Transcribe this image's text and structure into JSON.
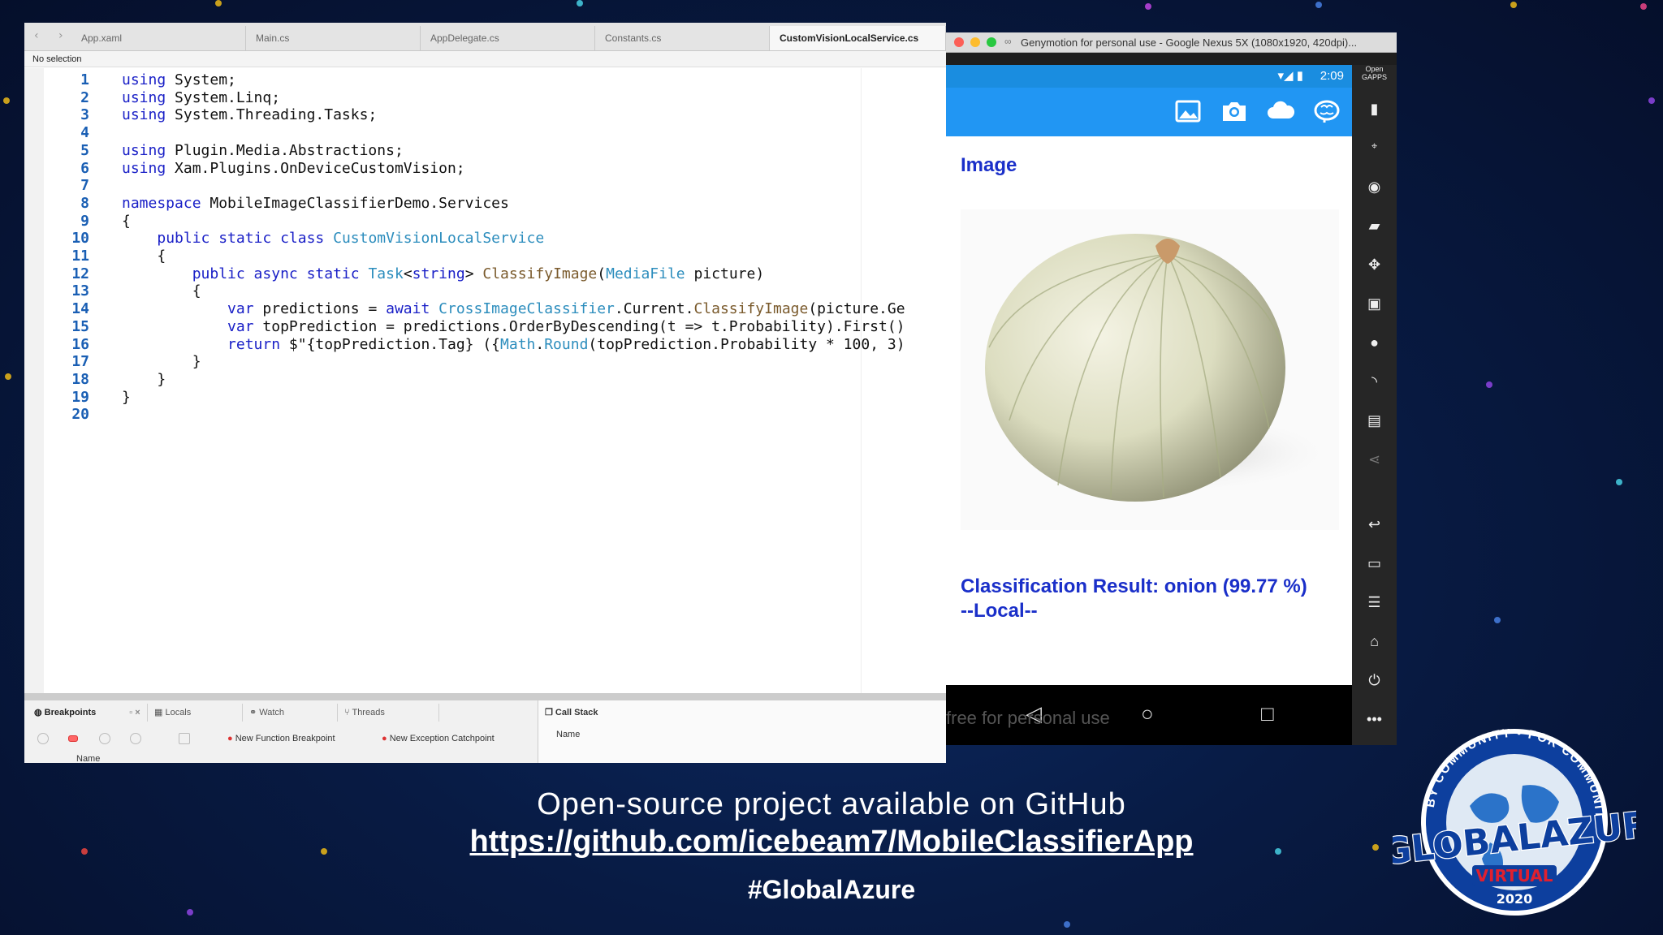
{
  "ide": {
    "tabs": [
      {
        "label": "App.xaml"
      },
      {
        "label": "Main.cs"
      },
      {
        "label": "AppDelegate.cs"
      },
      {
        "label": "Constants.cs"
      },
      {
        "label": "CustomVisionLocalService.cs",
        "active": true
      }
    ],
    "path_bar": "No selection",
    "code_lines": [
      {
        "n": "1",
        "tokens": [
          {
            "t": "using",
            "c": "kw"
          },
          {
            "t": " System;",
            "c": "pl"
          }
        ]
      },
      {
        "n": "2",
        "tokens": [
          {
            "t": "using",
            "c": "kw"
          },
          {
            "t": " System.Linq;",
            "c": "pl"
          }
        ]
      },
      {
        "n": "3",
        "tokens": [
          {
            "t": "using",
            "c": "kw"
          },
          {
            "t": " System.Threading.Tasks;",
            "c": "pl"
          }
        ]
      },
      {
        "n": "4",
        "tokens": []
      },
      {
        "n": "5",
        "tokens": [
          {
            "t": "using",
            "c": "kw"
          },
          {
            "t": " Plugin.Media.Abstractions;",
            "c": "pl"
          }
        ]
      },
      {
        "n": "6",
        "tokens": [
          {
            "t": "using",
            "c": "kw"
          },
          {
            "t": " Xam.Plugins.OnDeviceCustomVision;",
            "c": "pl"
          }
        ]
      },
      {
        "n": "7",
        "tokens": []
      },
      {
        "n": "8",
        "tokens": [
          {
            "t": "namespace",
            "c": "kw"
          },
          {
            "t": " MobileImageClassifierDemo.Services",
            "c": "pl"
          }
        ]
      },
      {
        "n": "9",
        "tokens": [
          {
            "t": "{",
            "c": "pl"
          }
        ]
      },
      {
        "n": "10",
        "tokens": [
          {
            "t": "    ",
            "c": "pl"
          },
          {
            "t": "public static class",
            "c": "kw"
          },
          {
            "t": " ",
            "c": "pl"
          },
          {
            "t": "CustomVisionLocalService",
            "c": "ty"
          }
        ]
      },
      {
        "n": "11",
        "tokens": [
          {
            "t": "    {",
            "c": "pl"
          }
        ]
      },
      {
        "n": "12",
        "tokens": [
          {
            "t": "        ",
            "c": "pl"
          },
          {
            "t": "public async static",
            "c": "kw"
          },
          {
            "t": " ",
            "c": "pl"
          },
          {
            "t": "Task",
            "c": "ty"
          },
          {
            "t": "<",
            "c": "pl"
          },
          {
            "t": "string",
            "c": "kw"
          },
          {
            "t": "> ",
            "c": "pl"
          },
          {
            "t": "ClassifyImage",
            "c": "mt"
          },
          {
            "t": "(",
            "c": "pl"
          },
          {
            "t": "MediaFile",
            "c": "ty"
          },
          {
            "t": " picture)",
            "c": "pl"
          }
        ]
      },
      {
        "n": "13",
        "tokens": [
          {
            "t": "        {",
            "c": "pl"
          }
        ]
      },
      {
        "n": "14",
        "tokens": [
          {
            "t": "            ",
            "c": "pl"
          },
          {
            "t": "var",
            "c": "kw"
          },
          {
            "t": " predictions = ",
            "c": "pl"
          },
          {
            "t": "await",
            "c": "kw"
          },
          {
            "t": " ",
            "c": "pl"
          },
          {
            "t": "CrossImageClassifier",
            "c": "ty"
          },
          {
            "t": ".Current.",
            "c": "pl"
          },
          {
            "t": "ClassifyImage",
            "c": "mt"
          },
          {
            "t": "(picture.Ge",
            "c": "pl"
          }
        ]
      },
      {
        "n": "15",
        "tokens": [
          {
            "t": "            ",
            "c": "pl"
          },
          {
            "t": "var",
            "c": "kw"
          },
          {
            "t": " topPrediction = predictions.OrderByDescending(t => t.Probability).First()",
            "c": "pl"
          }
        ]
      },
      {
        "n": "16",
        "tokens": [
          {
            "t": "            ",
            "c": "pl"
          },
          {
            "t": "return",
            "c": "kw"
          },
          {
            "t": " $\"{topPrediction.Tag} ({",
            "c": "pl"
          },
          {
            "t": "Math",
            "c": "ty"
          },
          {
            "t": ".",
            "c": "pl"
          },
          {
            "t": "Round",
            "c": "ty"
          },
          {
            "t": "(topPrediction.Probability * 100, 3)",
            "c": "pl"
          }
        ]
      },
      {
        "n": "17",
        "tokens": [
          {
            "t": "        }",
            "c": "pl"
          }
        ]
      },
      {
        "n": "18",
        "tokens": [
          {
            "t": "    }",
            "c": "pl"
          }
        ]
      },
      {
        "n": "19",
        "tokens": [
          {
            "t": "}",
            "c": "pl"
          }
        ]
      },
      {
        "n": "20",
        "tokens": []
      }
    ],
    "debug": {
      "tabs": [
        "Breakpoints",
        "Locals",
        "Watch",
        "Threads"
      ],
      "new_function_breakpoint": "New Function Breakpoint",
      "new_exception_catchpoint": "New Exception Catchpoint",
      "name_header": "Name",
      "call_stack_title": "Call Stack",
      "call_stack_name_header": "Name"
    }
  },
  "emulator": {
    "title": "Genymotion for personal use - Google Nexus 5X (1080x1920, 420dpi)...",
    "clock": "2:09",
    "image_heading": "Image",
    "result_text": "Classification Result: onion (99.77 %) --Local--",
    "watermark": "free for personal use",
    "side_top_label": "Open GAPPS"
  },
  "captions": {
    "line1": "Open-source project available on GitHub",
    "line2": "https://github.com/icebeam7/MobileClassifierApp",
    "line3": "#GlobalAzure"
  },
  "logo": {
    "ring_text": "BY COMMUNITY • FOR COMMUNITY",
    "main": "#GLOBALAZURE",
    "sub": "VIRTUAL",
    "year": "2020"
  },
  "colors": {
    "accent_blue": "#2196f3",
    "result_text": "#1a2fc9",
    "background": "#081b44"
  }
}
